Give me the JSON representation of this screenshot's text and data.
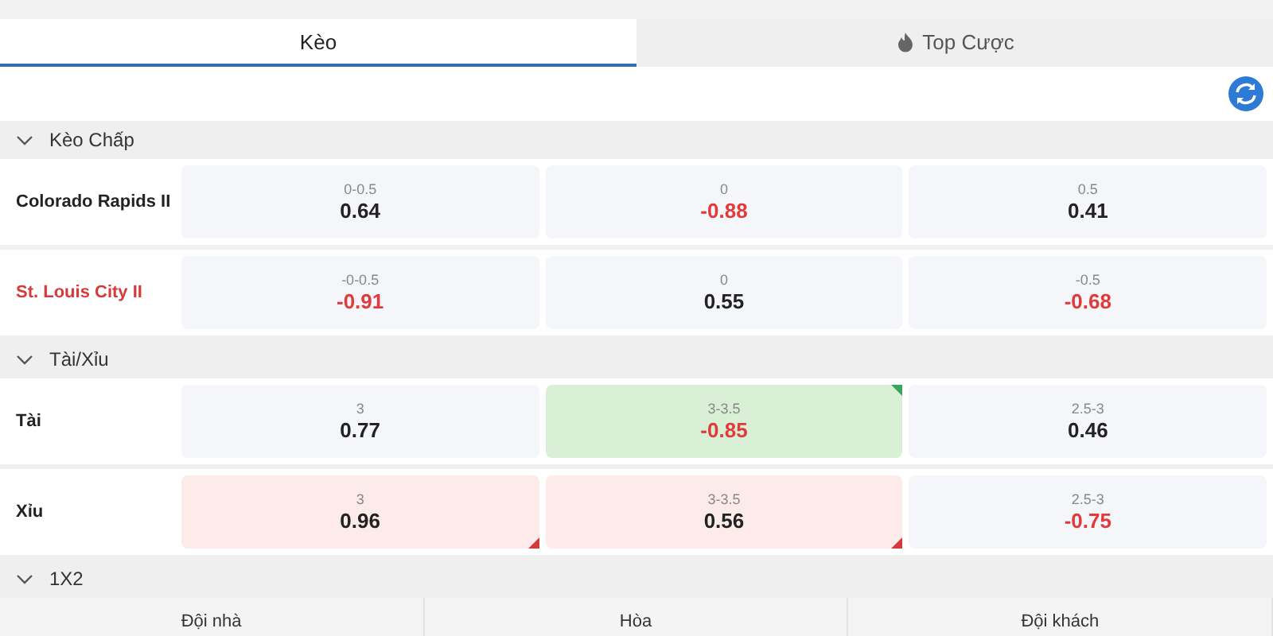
{
  "tabs": [
    {
      "label": "Kèo",
      "kind": "plain",
      "selected": true
    },
    {
      "label": "Top Cược",
      "kind": "hot",
      "selected": false
    }
  ],
  "sections": [
    {
      "title": "Kèo Chấp",
      "expanded": true,
      "rows": [
        {
          "name": "Colorado Rapids II",
          "highlighted": false,
          "cells": [
            {
              "line": "0-0.5",
              "odds": "0.64",
              "negative": false,
              "rising": false,
              "falling": false
            },
            {
              "line": "0",
              "odds": "-0.88",
              "negative": true,
              "rising": false,
              "falling": false
            },
            {
              "line": "0.5",
              "odds": "0.41",
              "negative": false,
              "rising": false,
              "falling": false
            }
          ]
        },
        {
          "name": "St. Louis City II",
          "highlighted": true,
          "cells": [
            {
              "line": "-0-0.5",
              "odds": "-0.91",
              "negative": true,
              "rising": false,
              "falling": false
            },
            {
              "line": "0",
              "odds": "0.55",
              "negative": false,
              "rising": false,
              "falling": false
            },
            {
              "line": "-0.5",
              "odds": "-0.68",
              "negative": true,
              "rising": false,
              "falling": false
            }
          ]
        }
      ]
    },
    {
      "title": "Tài/Xỉu",
      "expanded": true,
      "rows": [
        {
          "name": "Tài",
          "highlighted": false,
          "cells": [
            {
              "line": "3",
              "odds": "0.77",
              "negative": false,
              "rising": false,
              "falling": false
            },
            {
              "line": "3-3.5",
              "odds": "-0.85",
              "negative": true,
              "rising": true,
              "falling": false
            },
            {
              "line": "2.5-3",
              "odds": "0.46",
              "negative": false,
              "rising": false,
              "falling": false
            }
          ]
        },
        {
          "name": "Xỉu",
          "highlighted": false,
          "cells": [
            {
              "line": "3",
              "odds": "0.96",
              "negative": false,
              "rising": false,
              "falling": true
            },
            {
              "line": "3-3.5",
              "odds": "0.56",
              "negative": false,
              "rising": false,
              "falling": true
            },
            {
              "line": "2.5-3",
              "odds": "-0.75",
              "negative": true,
              "rising": false,
              "falling": false
            }
          ]
        }
      ]
    },
    {
      "title": "1X2",
      "expanded": true,
      "columns": [
        "Đội nhà",
        "Hòa",
        "Đội khách"
      ]
    }
  ]
}
